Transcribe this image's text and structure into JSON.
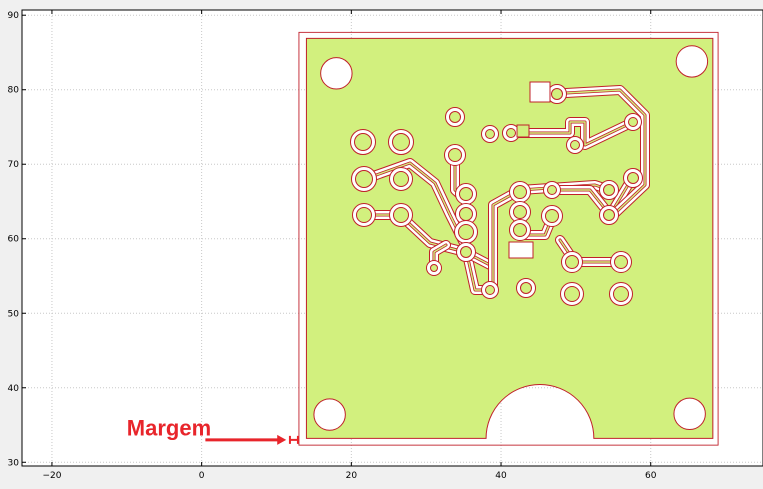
{
  "chart_data": {
    "type": "cam-preview",
    "xlim": [
      -24,
      75
    ],
    "ylim": [
      29.5,
      90.7
    ],
    "grid": true,
    "x_ticks": [
      {
        "v": -20,
        "label": "−20"
      },
      {
        "v": 0,
        "label": "0"
      },
      {
        "v": 20,
        "label": "20"
      },
      {
        "v": 40,
        "label": "40"
      },
      {
        "v": 60,
        "label": "60"
      }
    ],
    "y_ticks": [
      {
        "v": 30,
        "label": "30"
      },
      {
        "v": 40,
        "label": "40"
      },
      {
        "v": 50,
        "label": "50"
      },
      {
        "v": 60,
        "label": "60"
      },
      {
        "v": 70,
        "label": "70"
      },
      {
        "v": 80,
        "label": "80"
      },
      {
        "v": 90,
        "label": "90"
      }
    ],
    "margin_box": {
      "x": [
        13,
        69
      ],
      "y": [
        32.3,
        87.7
      ]
    },
    "board_rect": {
      "x": [
        14,
        68.3
      ],
      "y": [
        33.2,
        86.9
      ]
    },
    "board_cutout": {
      "cx": 45.2,
      "cy": 33.2,
      "r": 7.2
    },
    "mounting_holes": [
      {
        "x": 18,
        "y": 82.2,
        "r": 2.1
      },
      {
        "x": 65.5,
        "y": 83.8,
        "r": 2.1
      },
      {
        "x": 17.1,
        "y": 36.4,
        "r": 2.1
      },
      {
        "x": 65.2,
        "y": 36.5,
        "r": 2.1
      }
    ],
    "annotation": {
      "text": "Margem",
      "x": -10,
      "y": 33.6,
      "arrow_from": [
        0.5,
        33
      ],
      "arrow_to": [
        11.3,
        33
      ]
    },
    "colors": {
      "copper": "#d2f07e",
      "outline": "#c0202a",
      "annotation": "#e8252b"
    }
  }
}
